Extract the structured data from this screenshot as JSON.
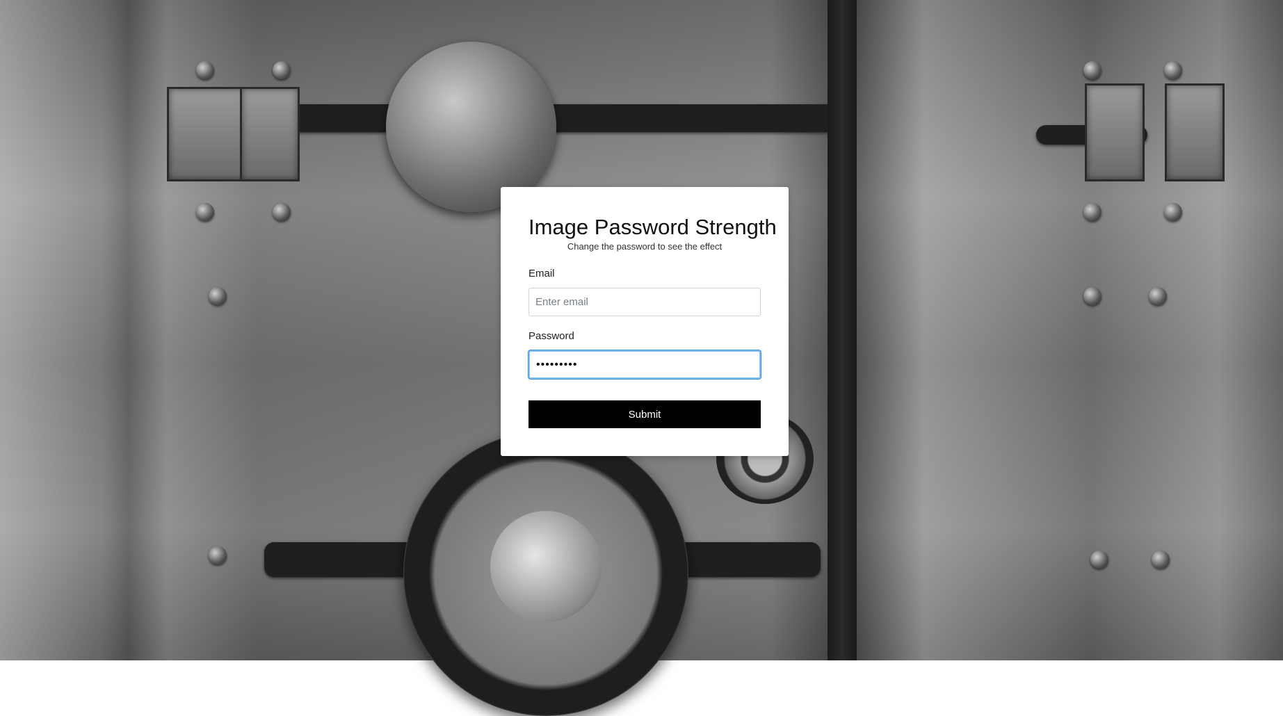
{
  "form": {
    "title": "Image Password Strength",
    "subtitle": "Change the password to see the effect",
    "email_label": "Email",
    "email_placeholder": "Enter email",
    "email_value": "",
    "password_label": "Password",
    "password_value": "•••••••••",
    "submit_label": "Submit"
  },
  "background": {
    "description_icon": "vault-door-image"
  },
  "colors": {
    "submit_bg": "#000000",
    "focus_border": "#80bdff"
  }
}
